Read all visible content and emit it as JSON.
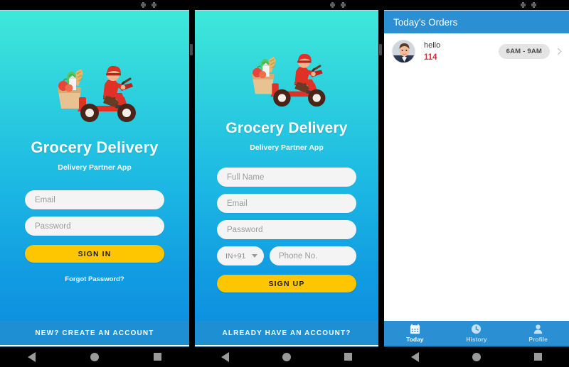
{
  "theme": {
    "gradient_top": "#3fe9d9",
    "gradient_bottom": "#0c8cdf",
    "accent_yellow": "#fdc600",
    "banner_blue": "#1f8fd4",
    "appbar_blue": "#2b8fd4",
    "order_id_red": "#e12b3c"
  },
  "screens": [
    {
      "id": "sign-in",
      "brand": {
        "illustration": "grocery-delivery-scooter-illustration",
        "title": "Grocery Delivery",
        "subtitle": "Delivery Partner App"
      },
      "fields": [
        {
          "name": "email-field",
          "placeholder": "Email",
          "value": ""
        },
        {
          "name": "password-field",
          "placeholder": "Password",
          "value": ""
        }
      ],
      "submit_label": "SIGN IN",
      "forgot_label": "Forgot Password?",
      "banner_label": "NEW? CREATE AN ACCOUNT"
    },
    {
      "id": "sign-up",
      "brand": {
        "illustration": "grocery-delivery-scooter-illustration",
        "title": "Grocery Delivery",
        "subtitle": "Delivery Partner App"
      },
      "fields": [
        {
          "name": "full-name-field",
          "placeholder": "Full Name",
          "value": ""
        },
        {
          "name": "email-field",
          "placeholder": "Email",
          "value": ""
        },
        {
          "name": "password-field",
          "placeholder": "Password",
          "value": ""
        }
      ],
      "country_code": {
        "selected": "IN+91"
      },
      "phone_field": {
        "placeholder": "Phone No.",
        "value": ""
      },
      "submit_label": "SIGN UP",
      "banner_label": "ALREADY HAVE AN ACCOUNT?"
    },
    {
      "id": "todays-orders",
      "appbar_title": "Today's Orders",
      "orders": [
        {
          "avatar": "user-avatar-photo",
          "customer": "hello",
          "order_id": "114",
          "time_slot": "6AM - 9AM"
        }
      ],
      "bottom_nav": [
        {
          "icon": "calendar-icon",
          "label": "Today",
          "active": true
        },
        {
          "icon": "clock-icon",
          "label": "History",
          "active": false
        },
        {
          "icon": "person-icon",
          "label": "Profile",
          "active": false
        }
      ]
    }
  ],
  "system_nav": {
    "back": "back-button",
    "home": "home-button",
    "recents": "recents-button"
  }
}
